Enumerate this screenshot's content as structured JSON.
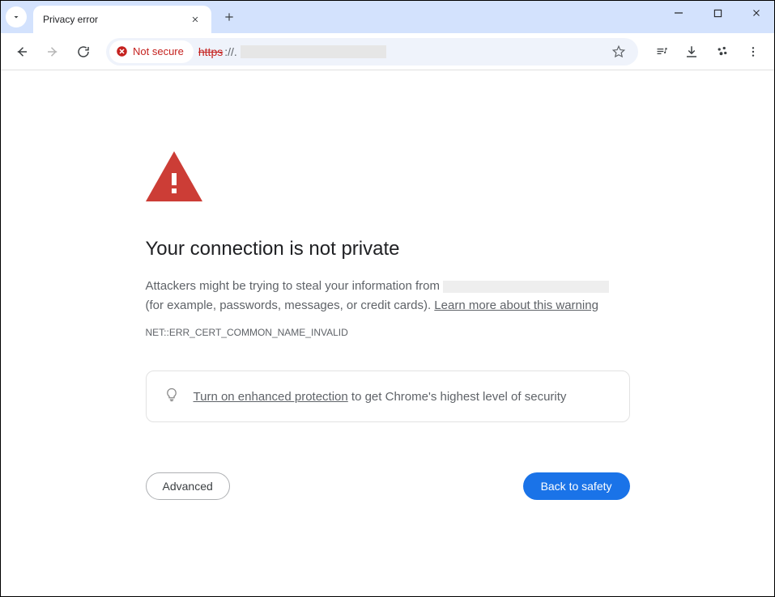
{
  "tab": {
    "title": "Privacy error"
  },
  "toolbar": {
    "security_label": "Not secure",
    "url_scheme": "https",
    "url_sep": "://."
  },
  "page": {
    "headline": "Your connection is not private",
    "body_before": "Attackers might be trying to steal your information from ",
    "body_after": " (for example, passwords, messages, or credit cards). ",
    "learn_more": "Learn more about this warning",
    "error_code": "NET::ERR_CERT_COMMON_NAME_INVALID",
    "tip_link": "Turn on enhanced protection",
    "tip_rest": " to get Chrome's highest level of security",
    "advanced": "Advanced",
    "back_to_safety": "Back to safety"
  }
}
